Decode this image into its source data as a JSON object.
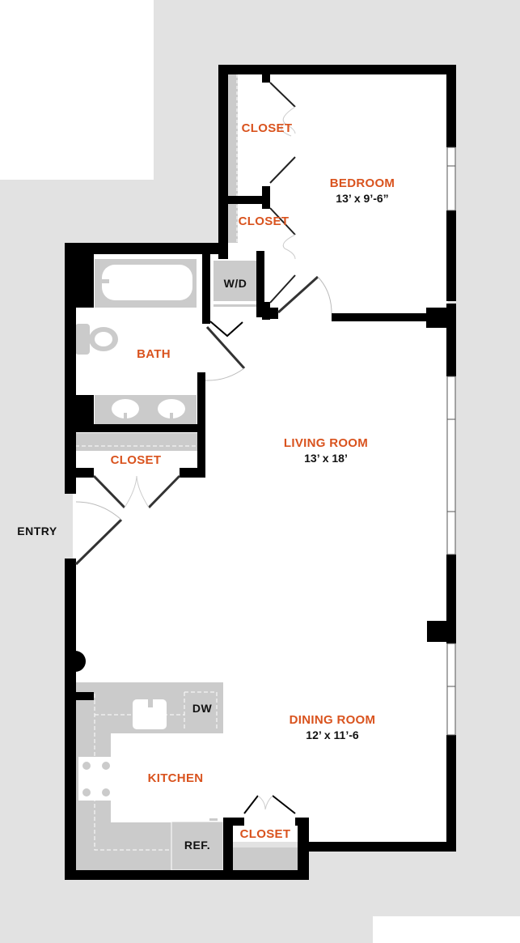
{
  "colors": {
    "wall": "#000000",
    "background": "#e2e2e2",
    "fixture": "#cbcbcb",
    "room_label": "#d9531e",
    "text": "#111111"
  },
  "rooms": {
    "bedroom": {
      "name": "BEDROOM",
      "dims": "13’ x 9’-6”"
    },
    "bedroom_closet_1": {
      "name": "CLOSET"
    },
    "bedroom_closet_2": {
      "name": "CLOSET"
    },
    "bath": {
      "name": "BATH"
    },
    "hall_closet": {
      "name": "CLOSET"
    },
    "living_room": {
      "name": "LIVING ROOM",
      "dims": "13’ x  18’"
    },
    "dining_room": {
      "name": "DINING ROOM",
      "dims": "12’ x  11’-6"
    },
    "kitchen": {
      "name": "KITCHEN"
    },
    "kitchen_closet": {
      "name": "CLOSET"
    }
  },
  "fixtures": {
    "washer_dryer": "W/D",
    "dishwasher": "DW",
    "refrigerator": "REF."
  },
  "entry_label": "ENTRY"
}
